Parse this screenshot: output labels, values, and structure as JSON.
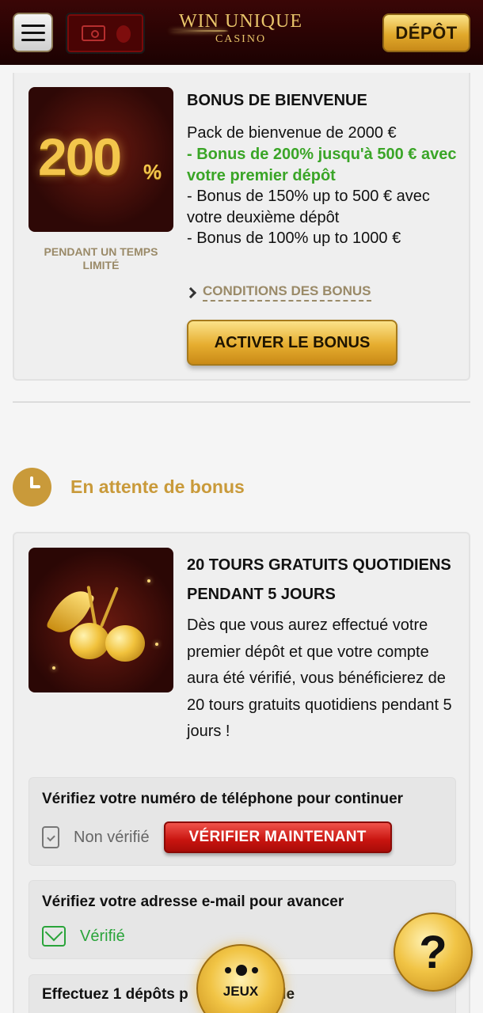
{
  "header": {
    "menu_icon": "hamburger-icon",
    "ticket_icon": "ticket-icon",
    "logo_line1": "WIN UNIQUE",
    "logo_line2": "CASINO",
    "deposit_label": "DÉPÔT"
  },
  "welcome_bonus": {
    "image_text": "200",
    "image_suffix": "%",
    "time_limit": "PENDANT UN TEMPS LIMITÉ",
    "title": "BONUS DE BIENVENUE",
    "line1": "Pack de bienvenue de 2000 €",
    "line2": "- Bonus de 200% jusqu'à 500 € avec votre premier dépôt",
    "line3": "- Bonus de 150% up to 500 € avec votre deuxième dépôt",
    "line4": "- Bonus de 100% up to 1000 €",
    "conditions_label": "CONDITIONS DES BONUS",
    "activate_label": "ACTIVER LE BONUS"
  },
  "pending": {
    "icon": "clock-icon",
    "label": "En attente de bonus"
  },
  "free_spins": {
    "title": "20 TOURS GRATUITS QUOTIDIENS PENDANT 5 JOURS",
    "description": "Dès que vous aurez effectué votre premier dépôt et que votre compte aura été vérifié, vous bénéficierez de 20 tours gratuits quotidiens pendant 5 jours !",
    "phone_step": {
      "title": "Vérifiez votre numéro de téléphone pour continuer",
      "status": "Non vérifié",
      "button": "VÉRIFIER MAINTENANT"
    },
    "email_step": {
      "title": "Vérifiez votre adresse e-mail pour avancer",
      "status": "Vérifié"
    },
    "deposit_step": {
      "title": "Effectuez 1 dépôts p",
      "title_tail": "gible"
    }
  },
  "floating": {
    "help_label": "?",
    "games_label": "JEUX"
  },
  "colors": {
    "header_bg": "#2a0404",
    "gold": "#e6ad2f",
    "accent_text": "#c99a3a",
    "green": "#3aa527",
    "red_button": "#c8140f"
  }
}
